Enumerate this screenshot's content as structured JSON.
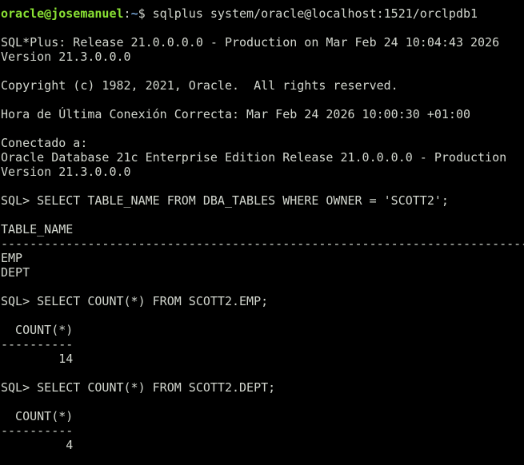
{
  "colors": {
    "background": "#000000",
    "text": "#d3d7cf",
    "prompt_user": "#8ae234",
    "prompt_path": "#729fcf"
  },
  "prompt": {
    "user_host": "oracle@josemanuel",
    "sep": ":",
    "path": "~",
    "symbol": "$ ",
    "command": "sqlplus system/oracle@localhost:1521/orclpdb1"
  },
  "banner": {
    "release": "SQL*Plus: Release 21.0.0.0.0 - Production on Mar Feb 24 10:04:43 2026",
    "version": "Version 21.3.0.0.0",
    "copyright": "Copyright (c) 1982, 2021, Oracle.  All rights reserved.",
    "last_login": "Hora de Última Conexión Correcta: Mar Feb 24 2026 10:00:30 +01:00",
    "connected": "Conectado a:",
    "database": "Oracle Database 21c Enterprise Edition Release 21.0.0.0.0 - Production",
    "db_version": "Version 21.3.0.0.0"
  },
  "query1": {
    "command": "SQL> SELECT TABLE_NAME FROM DBA_TABLES WHERE OWNER = 'SCOTT2';",
    "header": "TABLE_NAME",
    "separator": "--------------------------------------------------------------------------------",
    "rows": [
      "EMP",
      "DEPT"
    ]
  },
  "query2": {
    "command": "SQL> SELECT COUNT(*) FROM SCOTT2.EMP;",
    "header": "  COUNT(*)",
    "separator": "----------",
    "value": "        14"
  },
  "query3": {
    "command": "SQL> SELECT COUNT(*) FROM SCOTT2.DEPT;",
    "header": "  COUNT(*)",
    "separator": "----------",
    "value": "         4"
  }
}
